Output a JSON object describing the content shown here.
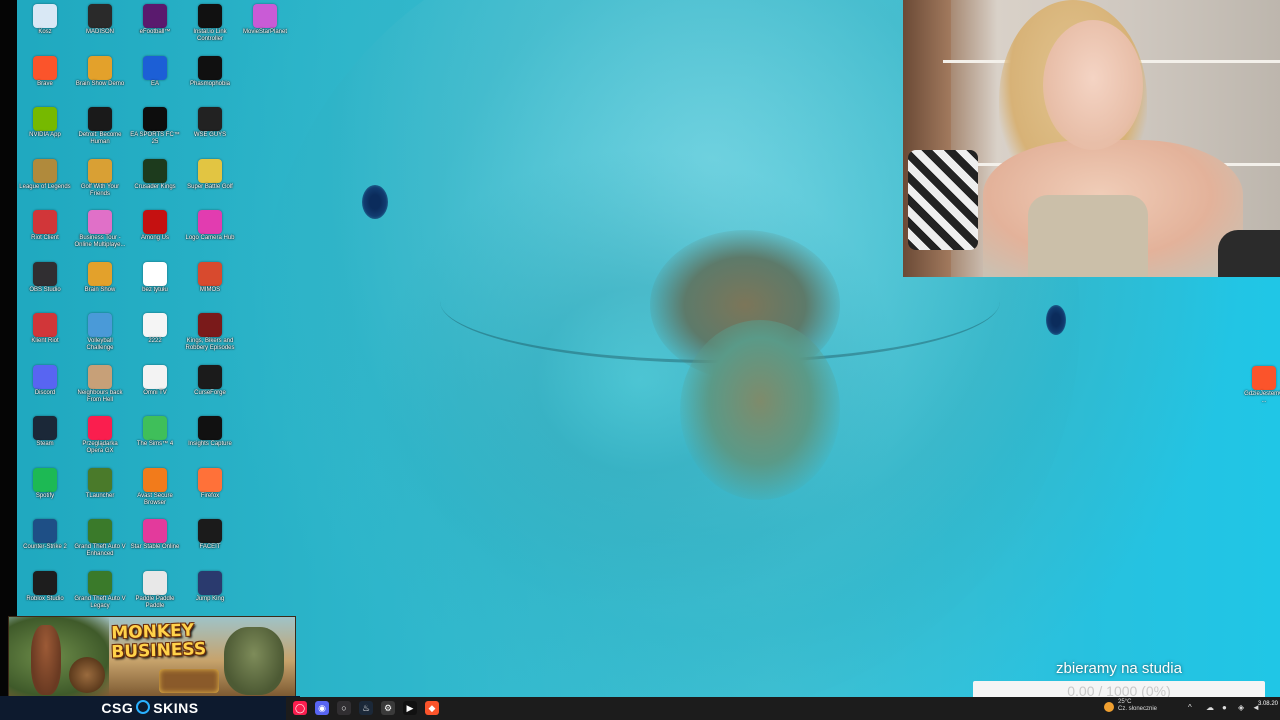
{
  "desktop_icons": [
    {
      "label": "Kosz",
      "icon": "recycle-bin-icon",
      "color": "#d9e8f5"
    },
    {
      "label": "MADISON",
      "icon": "madison-game-icon",
      "color": "#2a2a2a"
    },
    {
      "label": "eFootball™",
      "icon": "efootball-icon",
      "color": "#5a1a6e"
    },
    {
      "label": "Instal.io Link Controller",
      "icon": "controller-app-icon",
      "color": "#111111"
    },
    {
      "label": "MovieStarPlanet",
      "icon": "moviestarplanet-icon",
      "color": "#c95bd6"
    },
    {
      "label": "Brave",
      "icon": "brave-browser-icon",
      "color": "#fb542b"
    },
    {
      "label": "Brain Show Demo",
      "icon": "brain-show-demo-icon",
      "color": "#e3a12b"
    },
    {
      "label": "EA",
      "icon": "ea-app-icon",
      "color": "#1c5fd6"
    },
    {
      "label": "Phasmophobia",
      "icon": "phasmophobia-icon",
      "color": "#101010"
    },
    {
      "label": "NVIDIA App",
      "icon": "nvidia-icon",
      "color": "#76b900"
    },
    {
      "label": "Detroit: Become Human",
      "icon": "detroit-icon",
      "color": "#1a1a1a"
    },
    {
      "label": "EA SPORTS FC™ 25",
      "icon": "ea-fc-icon",
      "color": "#0d0d0d"
    },
    {
      "label": "WSE GUYS",
      "icon": "wse-guys-icon",
      "color": "#222222"
    },
    {
      "label": "League of Legends",
      "icon": "league-of-legends-icon",
      "color": "#b08a3c"
    },
    {
      "label": "Golf With Your Friends",
      "icon": "golf-icon",
      "color": "#d9a034"
    },
    {
      "label": "Crusader Kings",
      "icon": "crusader-icon",
      "color": "#1d3b1d"
    },
    {
      "label": "Super Battle Golf",
      "icon": "super-battle-golf-icon",
      "color": "#e2c542"
    },
    {
      "label": "Riot Client",
      "icon": "riot-client-icon",
      "color": "#d13639"
    },
    {
      "label": "Business Tour - Online Multiplaye...",
      "icon": "business-tour-icon",
      "color": "#e070c8"
    },
    {
      "label": "Among Us",
      "icon": "among-us-icon",
      "color": "#c51111"
    },
    {
      "label": "Logo Camera Hub",
      "icon": "camera-hub-icon",
      "color": "#e23cb0"
    },
    {
      "label": "OBS Studio",
      "icon": "obs-icon",
      "color": "#302e31"
    },
    {
      "label": "Brain Show",
      "icon": "brain-show-icon",
      "color": "#e3a12b"
    },
    {
      "label": "bez tytułu",
      "icon": "blank-file-icon",
      "color": "#ffffff"
    },
    {
      "label": "MIMOS",
      "icon": "mimos-icon",
      "color": "#d84a2e"
    },
    {
      "label": "Klient Riot",
      "icon": "riot-client-alt-icon",
      "color": "#d13639"
    },
    {
      "label": "Volleyball Challenge",
      "icon": "volleyball-icon",
      "color": "#4a9ad8"
    },
    {
      "label": "2222",
      "icon": "document-icon",
      "color": "#f5f5f5"
    },
    {
      "label": "Kings, Bikers and Robbery Episodes",
      "icon": "kings-bikers-icon",
      "color": "#7a1a1a"
    },
    {
      "label": "Discord",
      "icon": "discord-icon",
      "color": "#5865f2"
    },
    {
      "label": "Neighbours back From Hell",
      "icon": "neighbours-icon",
      "color": "#c7a078"
    },
    {
      "label": "Omni TV",
      "icon": "omni-tv-icon",
      "color": "#f3f3f3"
    },
    {
      "label": "CurseForge",
      "icon": "curseforge-icon",
      "color": "#1b1b1b"
    },
    {
      "label": "Steam",
      "icon": "steam-icon",
      "color": "#1b2838"
    },
    {
      "label": "Przeglądarka Opera GX",
      "icon": "opera-gx-icon",
      "color": "#fa1e4e"
    },
    {
      "label": "The Sims™ 4",
      "icon": "sims-icon",
      "color": "#3fbf5a"
    },
    {
      "label": "Insights Capture",
      "icon": "insights-capture-icon",
      "color": "#111111"
    },
    {
      "label": "Spotify",
      "icon": "spotify-icon",
      "color": "#1db954"
    },
    {
      "label": "TLauncher",
      "icon": "tlauncher-icon",
      "color": "#4a7a2a"
    },
    {
      "label": "Avast Secure Browser",
      "icon": "avast-browser-icon",
      "color": "#f27b1b"
    },
    {
      "label": "Firefox",
      "icon": "firefox-icon",
      "color": "#ff7139"
    },
    {
      "label": "Counter-Strike 2",
      "icon": "counter-strike-icon",
      "color": "#1e4f86"
    },
    {
      "label": "Grand Theft Auto V Enhanced",
      "icon": "gta-v-enhanced-icon",
      "color": "#3a7a2a"
    },
    {
      "label": "Star Stable Online",
      "icon": "star-stable-icon",
      "color": "#e33a9c"
    },
    {
      "label": "FACEIT",
      "icon": "faceit-icon",
      "color": "#1b1b1b"
    },
    {
      "label": "Roblox Studio",
      "icon": "roblox-studio-icon",
      "color": "#1d1d1d"
    },
    {
      "label": "Grand Theft Auto V Legacy",
      "icon": "gta-v-legacy-icon",
      "color": "#3a7a2a"
    },
    {
      "label": "Paddle Paddle Paddle",
      "icon": "paddle-icon",
      "color": "#e8e8e8"
    },
    {
      "label": "Jump King",
      "icon": "jump-king-icon",
      "color": "#2a3a6e"
    }
  ],
  "right_desktop_icon": {
    "label": "GdzieJestemQ...",
    "icon": "brave-shortcut-icon",
    "color": "#fb542b"
  },
  "ad": {
    "title": "MONKEY BUSINESS"
  },
  "sponsor": {
    "text_left": "CSG",
    "text_right": "SKINS"
  },
  "donation_goal": {
    "title": "zbieramy na studia",
    "progress_text": "0.00 / 1000 (0%)",
    "current": 0,
    "target": 1000,
    "fill_fraction": 0
  },
  "taskbar_icons": [
    {
      "icon": "opera-gx-taskbar-icon",
      "color": "#fa1e4e",
      "glyph": "◯"
    },
    {
      "icon": "discord-taskbar-icon",
      "color": "#5865f2",
      "glyph": "◉"
    },
    {
      "icon": "obs-taskbar-icon",
      "color": "#302e31",
      "glyph": "○"
    },
    {
      "icon": "steam-taskbar-icon",
      "color": "#1b2838",
      "glyph": "♨"
    },
    {
      "icon": "settings-taskbar-icon",
      "color": "#3a3a3a",
      "glyph": "⚙"
    },
    {
      "icon": "capture-taskbar-icon",
      "color": "#111111",
      "glyph": "▶"
    },
    {
      "icon": "brave-taskbar-icon",
      "color": "#fb542b",
      "glyph": "◆"
    }
  ],
  "weather": {
    "temp": "25°C",
    "desc": "Cz. słonecznie"
  },
  "clock": {
    "date": "3.08.20"
  }
}
